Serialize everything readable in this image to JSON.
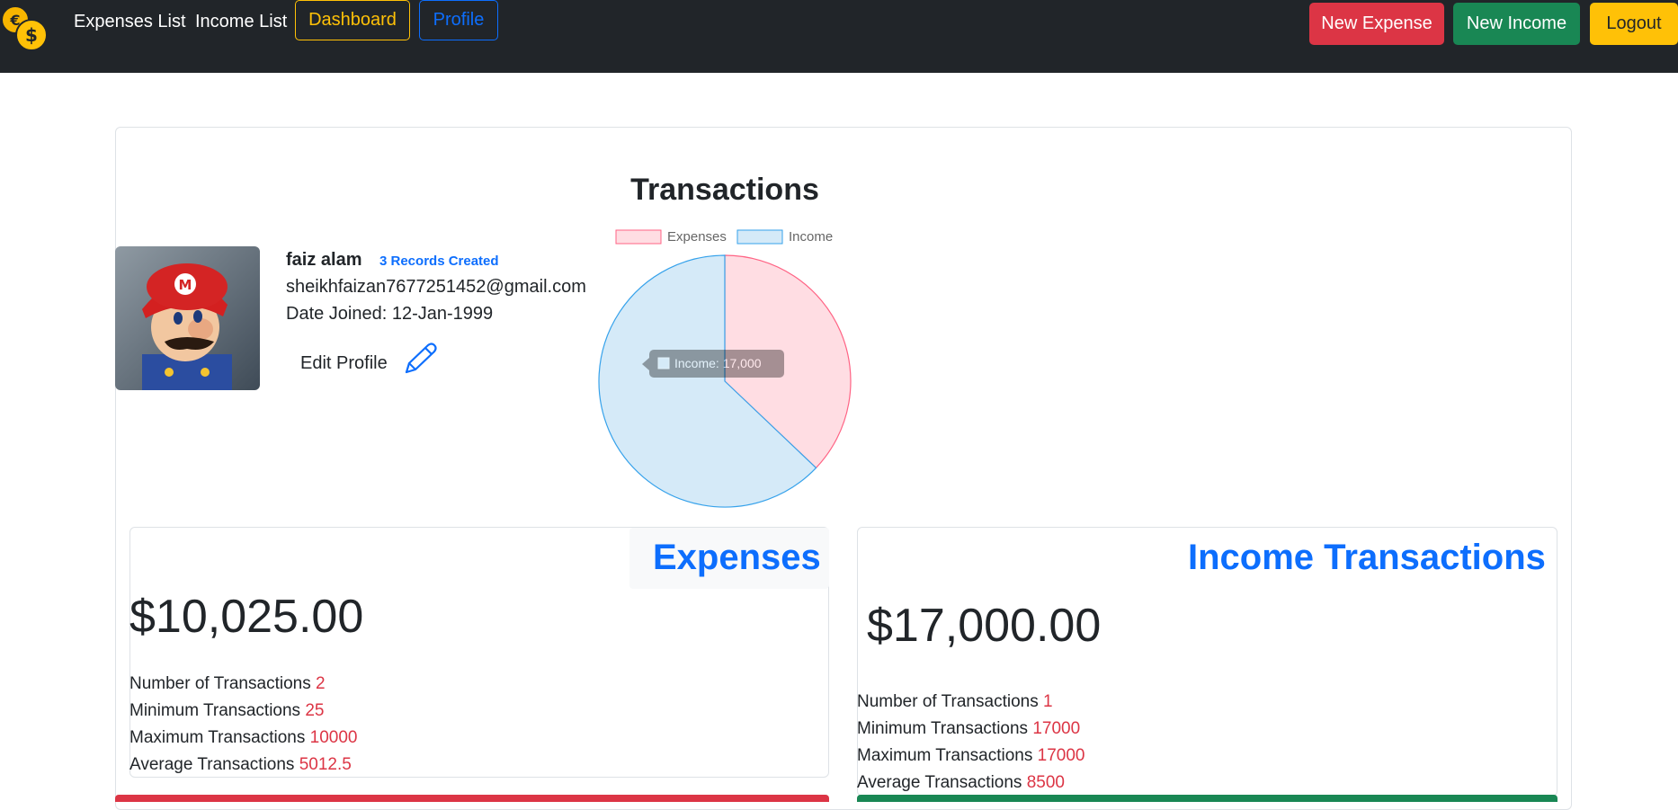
{
  "nav": {
    "links": [
      "Expenses List",
      "Income List"
    ],
    "dashboard_label": "Dashboard",
    "profile_label": "Profile",
    "new_expense_label": "New Expense",
    "new_income_label": "New Income",
    "logout_label": "Logout"
  },
  "profile": {
    "name": "faiz alam",
    "records_badge": "3 Records Created",
    "email": "sheikhfaizan7677251452@gmail.com",
    "date_joined": "Date Joined: 12-Jan-1999",
    "edit_label": "Edit Profile"
  },
  "chart_data": {
    "type": "pie",
    "title": "Transactions",
    "categories": [
      "Expenses",
      "Income"
    ],
    "values": [
      10025,
      17000
    ],
    "colors": [
      "#ffdde3",
      "#d5eaf8"
    ],
    "borders": [
      "#ff6384",
      "#36a2eb"
    ],
    "legend_position": "top",
    "tooltip": "Income: 17,000"
  },
  "expenses": {
    "title": "Expenses",
    "amount": "$10,025.00",
    "count_label": "Number of Transactions",
    "count": "2",
    "min_label": "Minimum Transactions",
    "min": "25",
    "max_label": "Maximum Transactions",
    "max": "10000",
    "avg_label": "Average Transactions",
    "avg": "5012.5"
  },
  "income": {
    "title": "Income Transactions",
    "amount": "$17,000.00",
    "count_label": "Number of Transactions",
    "count": "1",
    "min_label": "Minimum Transactions",
    "min": "17000",
    "max_label": "Maximum Transactions",
    "max": "17000",
    "avg_label": "Average Transactions",
    "avg": "8500"
  },
  "colors": {
    "navbar": "#212529",
    "danger": "#dc3545",
    "success": "#198754",
    "warning": "#ffc107",
    "primary": "#0d6efd"
  }
}
